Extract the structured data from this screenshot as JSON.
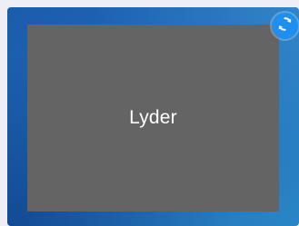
{
  "preview": {
    "label": "Lyder"
  },
  "icons": {
    "refresh": "refresh-icon"
  },
  "colors": {
    "preview_bg": "#646464",
    "tile_bg": "#1f68b6",
    "refresh_button": "#1e8fee"
  }
}
